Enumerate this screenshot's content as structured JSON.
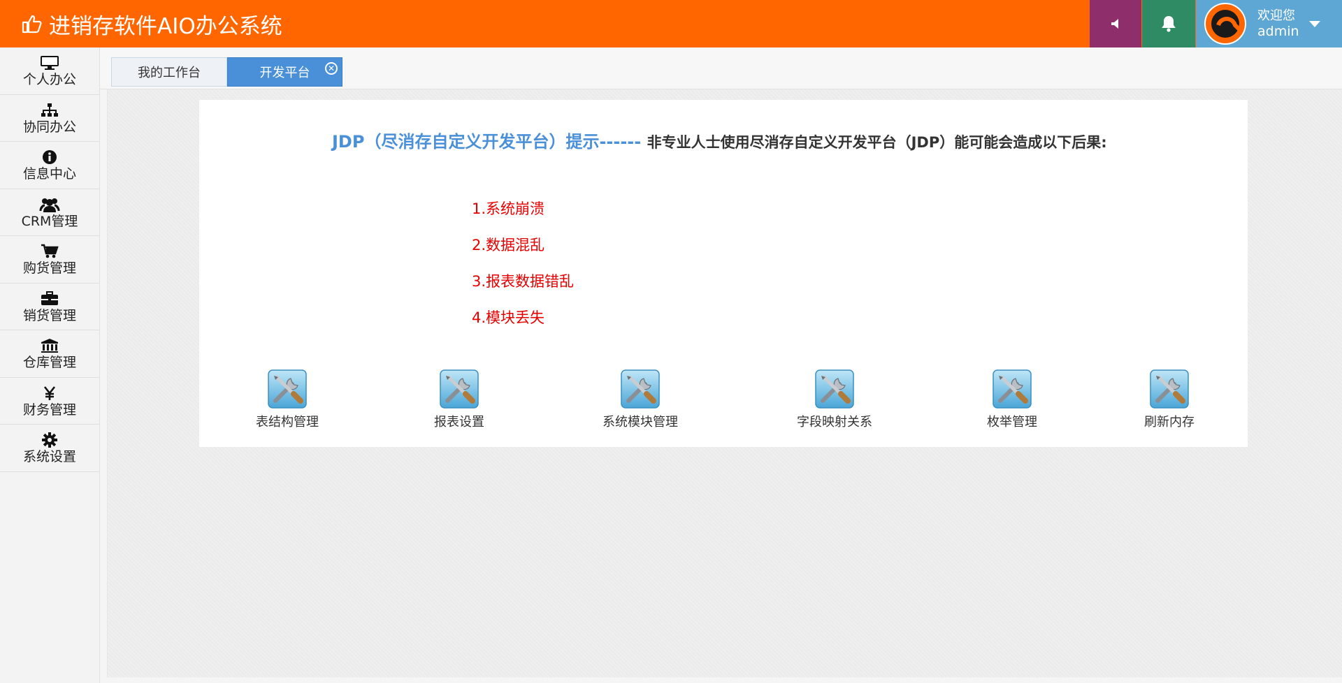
{
  "header": {
    "title": "进销存软件AIO办公系统",
    "welcome": "欢迎您",
    "username": "admin"
  },
  "colors": {
    "header_bg": "#ff6600",
    "sound_btn": "#8e2e6b",
    "bell_btn": "#2e8b63",
    "user_bg": "#5ea6d3",
    "active_tab": "#4a90d9",
    "warning_text": "#e60000"
  },
  "sidebar": {
    "items": [
      {
        "label": "个人办公",
        "icon": "monitor-icon"
      },
      {
        "label": "协同办公",
        "icon": "sitemap-icon"
      },
      {
        "label": "信息中心",
        "icon": "info-icon"
      },
      {
        "label": "CRM管理",
        "icon": "users-icon"
      },
      {
        "label": "购货管理",
        "icon": "cart-icon"
      },
      {
        "label": "销货管理",
        "icon": "briefcase-icon"
      },
      {
        "label": "仓库管理",
        "icon": "bank-icon"
      },
      {
        "label": "财务管理",
        "icon": "yen-icon"
      },
      {
        "label": "系统设置",
        "icon": "gear-icon"
      }
    ]
  },
  "tabs": [
    {
      "label": "我的工作台"
    },
    {
      "label": "开发平台"
    }
  ],
  "notice": {
    "title": "JDP（尽消存自定义开发平台）提示------",
    "text": "非专业人士使用尽消存自定义开发平台（JDP）能可能会造成以下后果:"
  },
  "warnings": [
    "1.系统崩溃",
    "2.数据混乱",
    "3.报表数据错乱",
    "4.模块丢失"
  ],
  "tools": [
    {
      "label": "表结构管理",
      "icon": "tools-icon"
    },
    {
      "label": "报表设置",
      "icon": "tools-icon"
    },
    {
      "label": "系统模块管理",
      "icon": "tools-icon"
    },
    {
      "label": "字段映射关系",
      "icon": "tools-icon"
    },
    {
      "label": "枚举管理",
      "icon": "tools-icon"
    },
    {
      "label": "刷新内存",
      "icon": "tools-icon"
    }
  ]
}
